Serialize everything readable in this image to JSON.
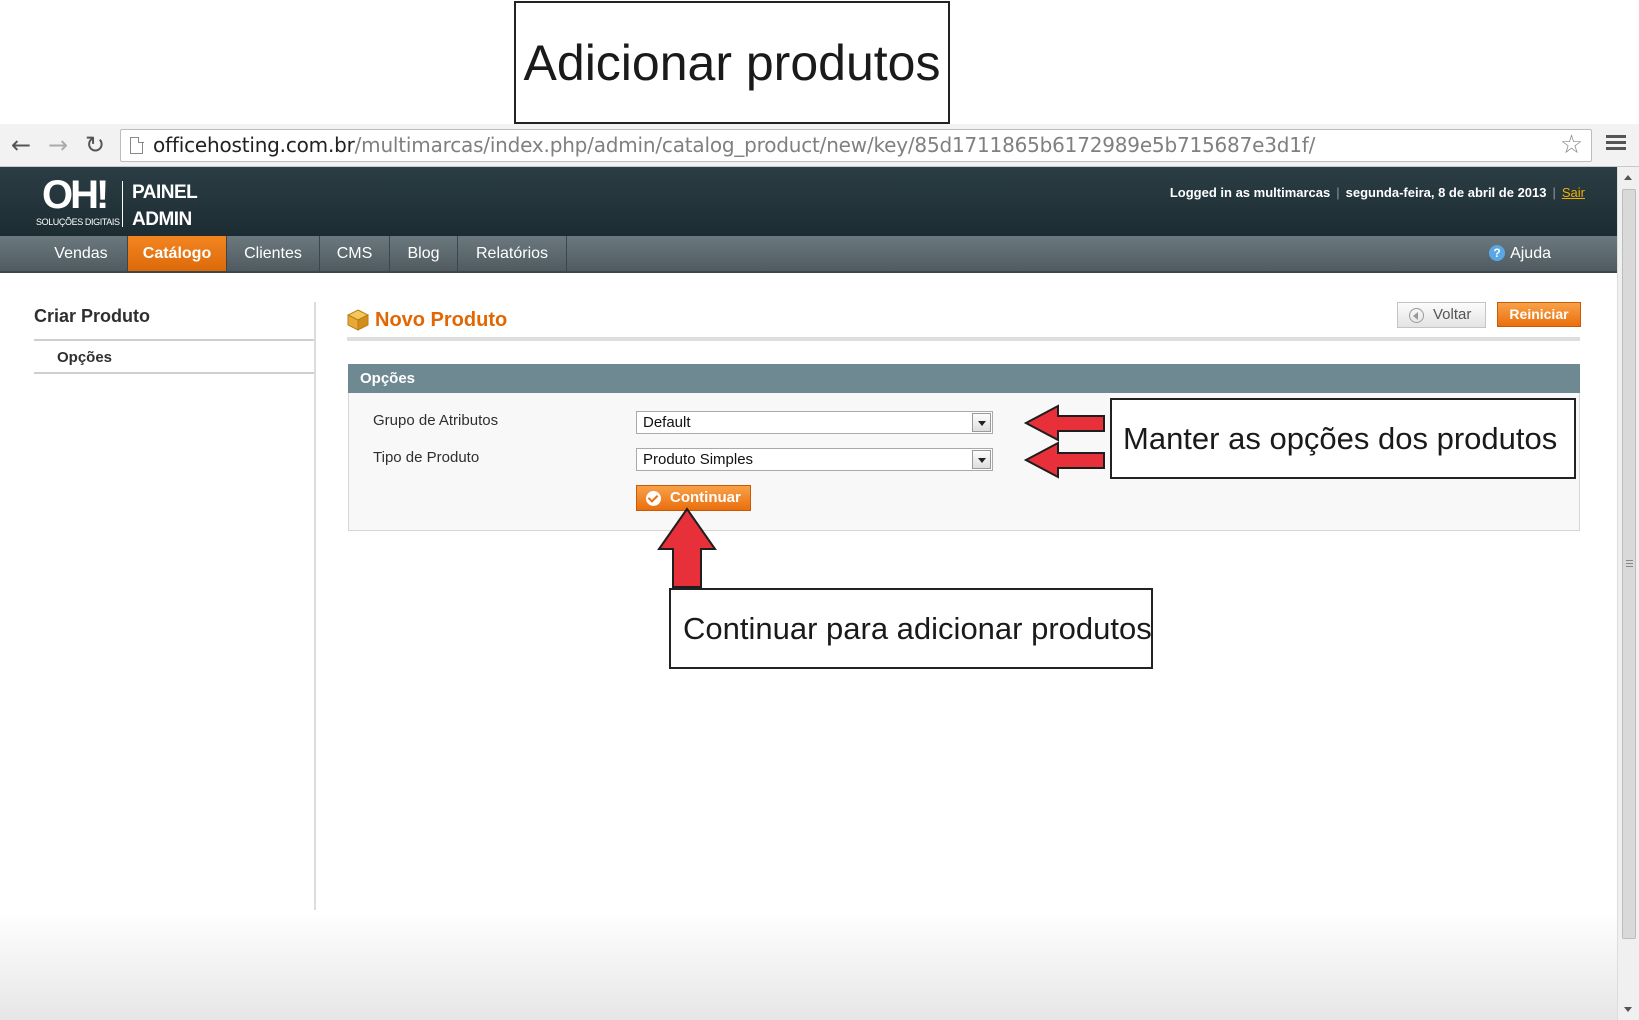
{
  "annotations": {
    "title": "Adicionar produtos",
    "options_note": "Manter as opções dos produtos",
    "continue_note": "Continuar para adicionar produtos"
  },
  "browser": {
    "url_host": "officehosting.com.br",
    "url_path": "/multimarcas/index.php/admin/catalog_product/new/key/85d1711865b6172989e5b715687e3d1f/",
    "back_glyph": "←",
    "forward_glyph": "→",
    "reload_glyph": "↻",
    "star_glyph": "☆"
  },
  "header": {
    "logo_mark": "OH!",
    "logo_sub": "SOLUÇÕES DIGITAIS",
    "logo_line1": "PAINEL",
    "logo_line2": "ADMIN",
    "logged_in": "Logged in as multimarcas",
    "date": "segunda-feira, 8 de abril de 2013",
    "logout": "Sair",
    "separator": "|"
  },
  "nav": {
    "items": [
      "Vendas",
      "Catálogo",
      "Clientes",
      "CMS",
      "Blog",
      "Relatórios"
    ],
    "active": "Catálogo",
    "help_label": "Ajuda",
    "help_glyph": "?"
  },
  "sidebar": {
    "title": "Criar Produto",
    "items": [
      "Opções"
    ]
  },
  "content": {
    "title": "Novo Produto",
    "back_button": "Voltar",
    "reset_button": "Reiniciar",
    "fieldset_title": "Opções",
    "fields": [
      {
        "label": "Grupo de Atributos",
        "value": "Default"
      },
      {
        "label": "Tipo de Produto",
        "value": "Produto Simples"
      }
    ],
    "continue_button": "Continuar"
  },
  "colors": {
    "accent_orange": "#ea6f0e",
    "title_orange": "#e26703",
    "header_dark": "#1d2c33",
    "fieldset_head": "#6f8992",
    "annotation_arrow": "#e8303a"
  },
  "icons": {
    "page": "page-icon",
    "star": "bookmark-star-icon",
    "menu": "hamburger-menu-icon",
    "help": "help-icon",
    "box": "product-box-icon",
    "back": "back-arrow-icon",
    "check": "check-icon"
  }
}
